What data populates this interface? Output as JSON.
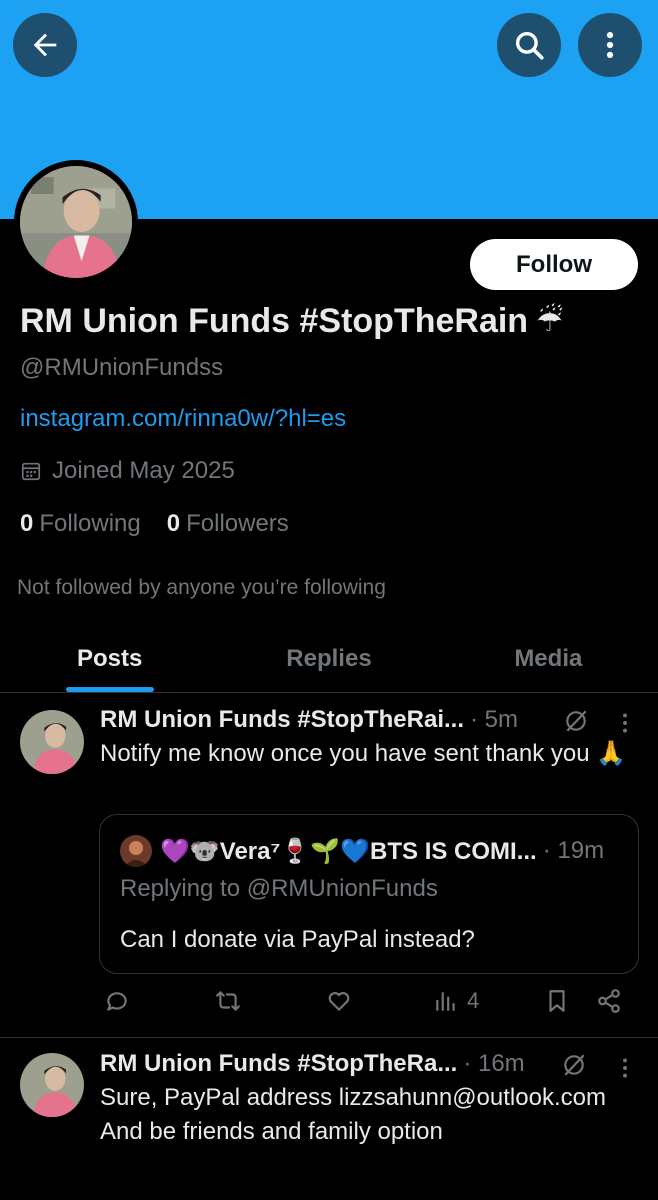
{
  "colors": {
    "banner": "#1da1f2",
    "accent": "#1d9bf0",
    "muted": "#71767b",
    "text": "#e7e9ea",
    "background": "#000000"
  },
  "header": {
    "back_icon": "arrow-left-icon",
    "search_icon": "search-icon",
    "more_icon": "more-vertical-icon"
  },
  "profile": {
    "name": "RM Union Funds #StopTheRain",
    "name_emoji": "☔",
    "handle": "@RMUnionFundss",
    "link": "instagram.com/rinna0w/?hl=es",
    "joined": "Joined May 2025",
    "following_count": "0",
    "following_label": "Following",
    "followers_count": "0",
    "followers_label": "Followers",
    "not_followed": "Not followed by anyone you’re following",
    "follow_label": "Follow"
  },
  "tabs": [
    {
      "label": "Posts",
      "active": true
    },
    {
      "label": "Replies",
      "active": false
    },
    {
      "label": "Media",
      "active": false
    }
  ],
  "posts": [
    {
      "name": "RM Union Funds #StopTheRai...",
      "time": "· 5m",
      "text": "Notify me know once you have sent thank you 🙏",
      "quote": {
        "name": "💜🐨Vera⁷🍷🌱💙BTS IS COMI...",
        "time": "· 19m",
        "replying_to": "Replying to @RMUnionFunds",
        "text": "Can I donate via PayPal instead?"
      },
      "views": "4"
    },
    {
      "name": "RM Union Funds #StopTheRa...",
      "time": "· 16m",
      "text": "Sure, PayPal address lizzsahunn@outlook.com And be friends and family option"
    }
  ]
}
